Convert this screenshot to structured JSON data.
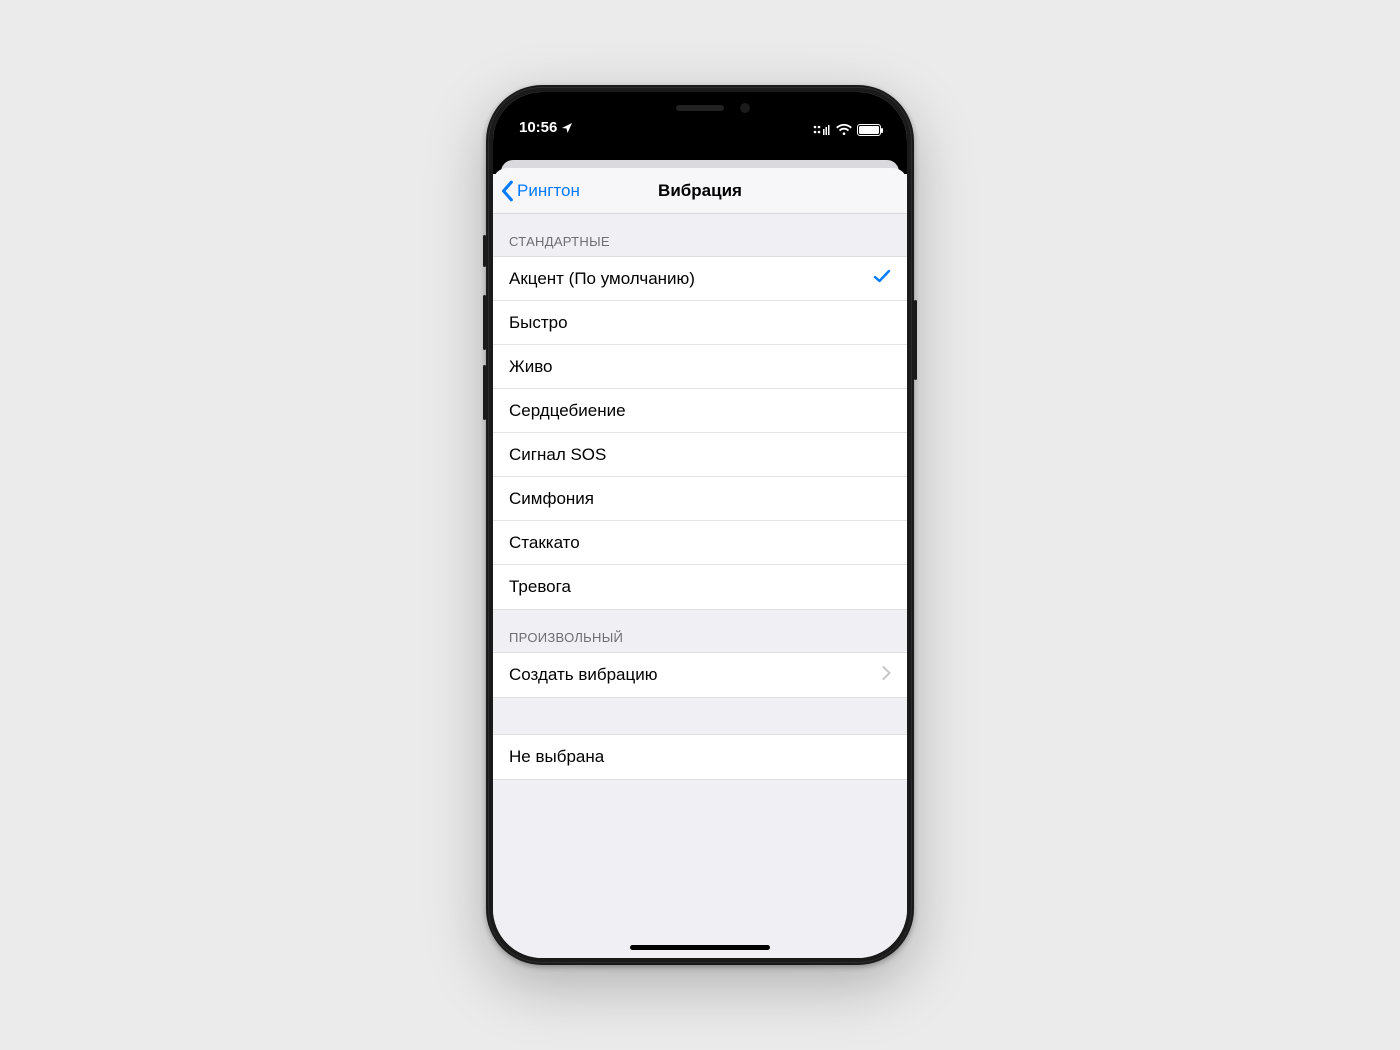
{
  "statusbar": {
    "time": "10:56"
  },
  "navbar": {
    "back_label": "Рингтон",
    "title": "Вибрация"
  },
  "sections": {
    "standard": {
      "header": "СТАНДАРТНЫЕ",
      "items": [
        {
          "label": "Акцент (По умолчанию)",
          "selected": true
        },
        {
          "label": "Быстро"
        },
        {
          "label": "Живо"
        },
        {
          "label": "Сердцебиение"
        },
        {
          "label": "Сигнал SOS"
        },
        {
          "label": "Симфония"
        },
        {
          "label": "Стаккато"
        },
        {
          "label": "Тревога"
        }
      ]
    },
    "custom": {
      "header": "ПРОИЗВОЛЬНЫЙ",
      "create_label": "Создать вибрацию"
    },
    "none": {
      "label": "Не выбрана"
    }
  }
}
